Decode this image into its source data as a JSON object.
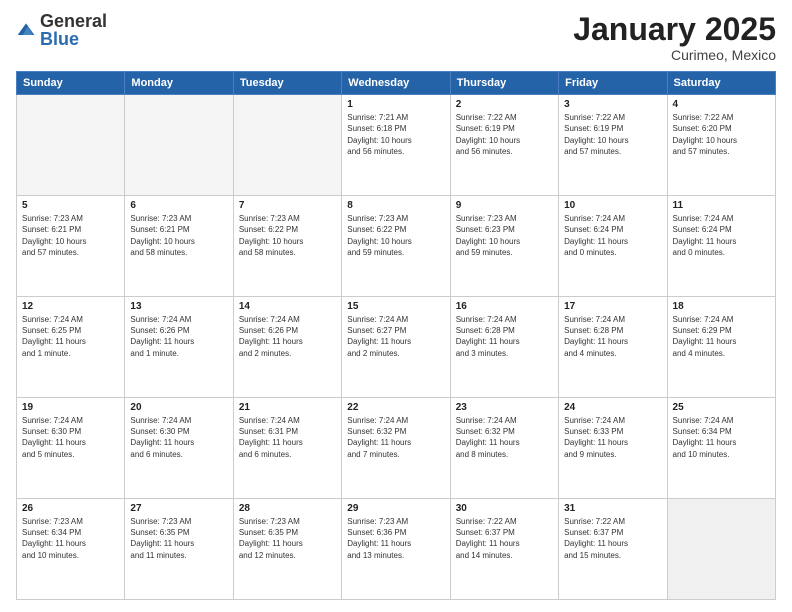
{
  "logo": {
    "general": "General",
    "blue": "Blue"
  },
  "title": "January 2025",
  "subtitle": "Curimeo, Mexico",
  "days_of_week": [
    "Sunday",
    "Monday",
    "Tuesday",
    "Wednesday",
    "Thursday",
    "Friday",
    "Saturday"
  ],
  "weeks": [
    [
      {
        "day": "",
        "info": "",
        "empty": true
      },
      {
        "day": "",
        "info": "",
        "empty": true
      },
      {
        "day": "",
        "info": "",
        "empty": true
      },
      {
        "day": "1",
        "info": "Sunrise: 7:21 AM\nSunset: 6:18 PM\nDaylight: 10 hours\nand 56 minutes.",
        "empty": false
      },
      {
        "day": "2",
        "info": "Sunrise: 7:22 AM\nSunset: 6:19 PM\nDaylight: 10 hours\nand 56 minutes.",
        "empty": false
      },
      {
        "day": "3",
        "info": "Sunrise: 7:22 AM\nSunset: 6:19 PM\nDaylight: 10 hours\nand 57 minutes.",
        "empty": false
      },
      {
        "day": "4",
        "info": "Sunrise: 7:22 AM\nSunset: 6:20 PM\nDaylight: 10 hours\nand 57 minutes.",
        "empty": false
      }
    ],
    [
      {
        "day": "5",
        "info": "Sunrise: 7:23 AM\nSunset: 6:21 PM\nDaylight: 10 hours\nand 57 minutes.",
        "empty": false
      },
      {
        "day": "6",
        "info": "Sunrise: 7:23 AM\nSunset: 6:21 PM\nDaylight: 10 hours\nand 58 minutes.",
        "empty": false
      },
      {
        "day": "7",
        "info": "Sunrise: 7:23 AM\nSunset: 6:22 PM\nDaylight: 10 hours\nand 58 minutes.",
        "empty": false
      },
      {
        "day": "8",
        "info": "Sunrise: 7:23 AM\nSunset: 6:22 PM\nDaylight: 10 hours\nand 59 minutes.",
        "empty": false
      },
      {
        "day": "9",
        "info": "Sunrise: 7:23 AM\nSunset: 6:23 PM\nDaylight: 10 hours\nand 59 minutes.",
        "empty": false
      },
      {
        "day": "10",
        "info": "Sunrise: 7:24 AM\nSunset: 6:24 PM\nDaylight: 11 hours\nand 0 minutes.",
        "empty": false
      },
      {
        "day": "11",
        "info": "Sunrise: 7:24 AM\nSunset: 6:24 PM\nDaylight: 11 hours\nand 0 minutes.",
        "empty": false
      }
    ],
    [
      {
        "day": "12",
        "info": "Sunrise: 7:24 AM\nSunset: 6:25 PM\nDaylight: 11 hours\nand 1 minute.",
        "empty": false
      },
      {
        "day": "13",
        "info": "Sunrise: 7:24 AM\nSunset: 6:26 PM\nDaylight: 11 hours\nand 1 minute.",
        "empty": false
      },
      {
        "day": "14",
        "info": "Sunrise: 7:24 AM\nSunset: 6:26 PM\nDaylight: 11 hours\nand 2 minutes.",
        "empty": false
      },
      {
        "day": "15",
        "info": "Sunrise: 7:24 AM\nSunset: 6:27 PM\nDaylight: 11 hours\nand 2 minutes.",
        "empty": false
      },
      {
        "day": "16",
        "info": "Sunrise: 7:24 AM\nSunset: 6:28 PM\nDaylight: 11 hours\nand 3 minutes.",
        "empty": false
      },
      {
        "day": "17",
        "info": "Sunrise: 7:24 AM\nSunset: 6:28 PM\nDaylight: 11 hours\nand 4 minutes.",
        "empty": false
      },
      {
        "day": "18",
        "info": "Sunrise: 7:24 AM\nSunset: 6:29 PM\nDaylight: 11 hours\nand 4 minutes.",
        "empty": false
      }
    ],
    [
      {
        "day": "19",
        "info": "Sunrise: 7:24 AM\nSunset: 6:30 PM\nDaylight: 11 hours\nand 5 minutes.",
        "empty": false
      },
      {
        "day": "20",
        "info": "Sunrise: 7:24 AM\nSunset: 6:30 PM\nDaylight: 11 hours\nand 6 minutes.",
        "empty": false
      },
      {
        "day": "21",
        "info": "Sunrise: 7:24 AM\nSunset: 6:31 PM\nDaylight: 11 hours\nand 6 minutes.",
        "empty": false
      },
      {
        "day": "22",
        "info": "Sunrise: 7:24 AM\nSunset: 6:32 PM\nDaylight: 11 hours\nand 7 minutes.",
        "empty": false
      },
      {
        "day": "23",
        "info": "Sunrise: 7:24 AM\nSunset: 6:32 PM\nDaylight: 11 hours\nand 8 minutes.",
        "empty": false
      },
      {
        "day": "24",
        "info": "Sunrise: 7:24 AM\nSunset: 6:33 PM\nDaylight: 11 hours\nand 9 minutes.",
        "empty": false
      },
      {
        "day": "25",
        "info": "Sunrise: 7:24 AM\nSunset: 6:34 PM\nDaylight: 11 hours\nand 10 minutes.",
        "empty": false
      }
    ],
    [
      {
        "day": "26",
        "info": "Sunrise: 7:23 AM\nSunset: 6:34 PM\nDaylight: 11 hours\nand 10 minutes.",
        "empty": false
      },
      {
        "day": "27",
        "info": "Sunrise: 7:23 AM\nSunset: 6:35 PM\nDaylight: 11 hours\nand 11 minutes.",
        "empty": false
      },
      {
        "day": "28",
        "info": "Sunrise: 7:23 AM\nSunset: 6:35 PM\nDaylight: 11 hours\nand 12 minutes.",
        "empty": false
      },
      {
        "day": "29",
        "info": "Sunrise: 7:23 AM\nSunset: 6:36 PM\nDaylight: 11 hours\nand 13 minutes.",
        "empty": false
      },
      {
        "day": "30",
        "info": "Sunrise: 7:22 AM\nSunset: 6:37 PM\nDaylight: 11 hours\nand 14 minutes.",
        "empty": false
      },
      {
        "day": "31",
        "info": "Sunrise: 7:22 AM\nSunset: 6:37 PM\nDaylight: 11 hours\nand 15 minutes.",
        "empty": false
      },
      {
        "day": "",
        "info": "",
        "empty": true
      }
    ]
  ]
}
